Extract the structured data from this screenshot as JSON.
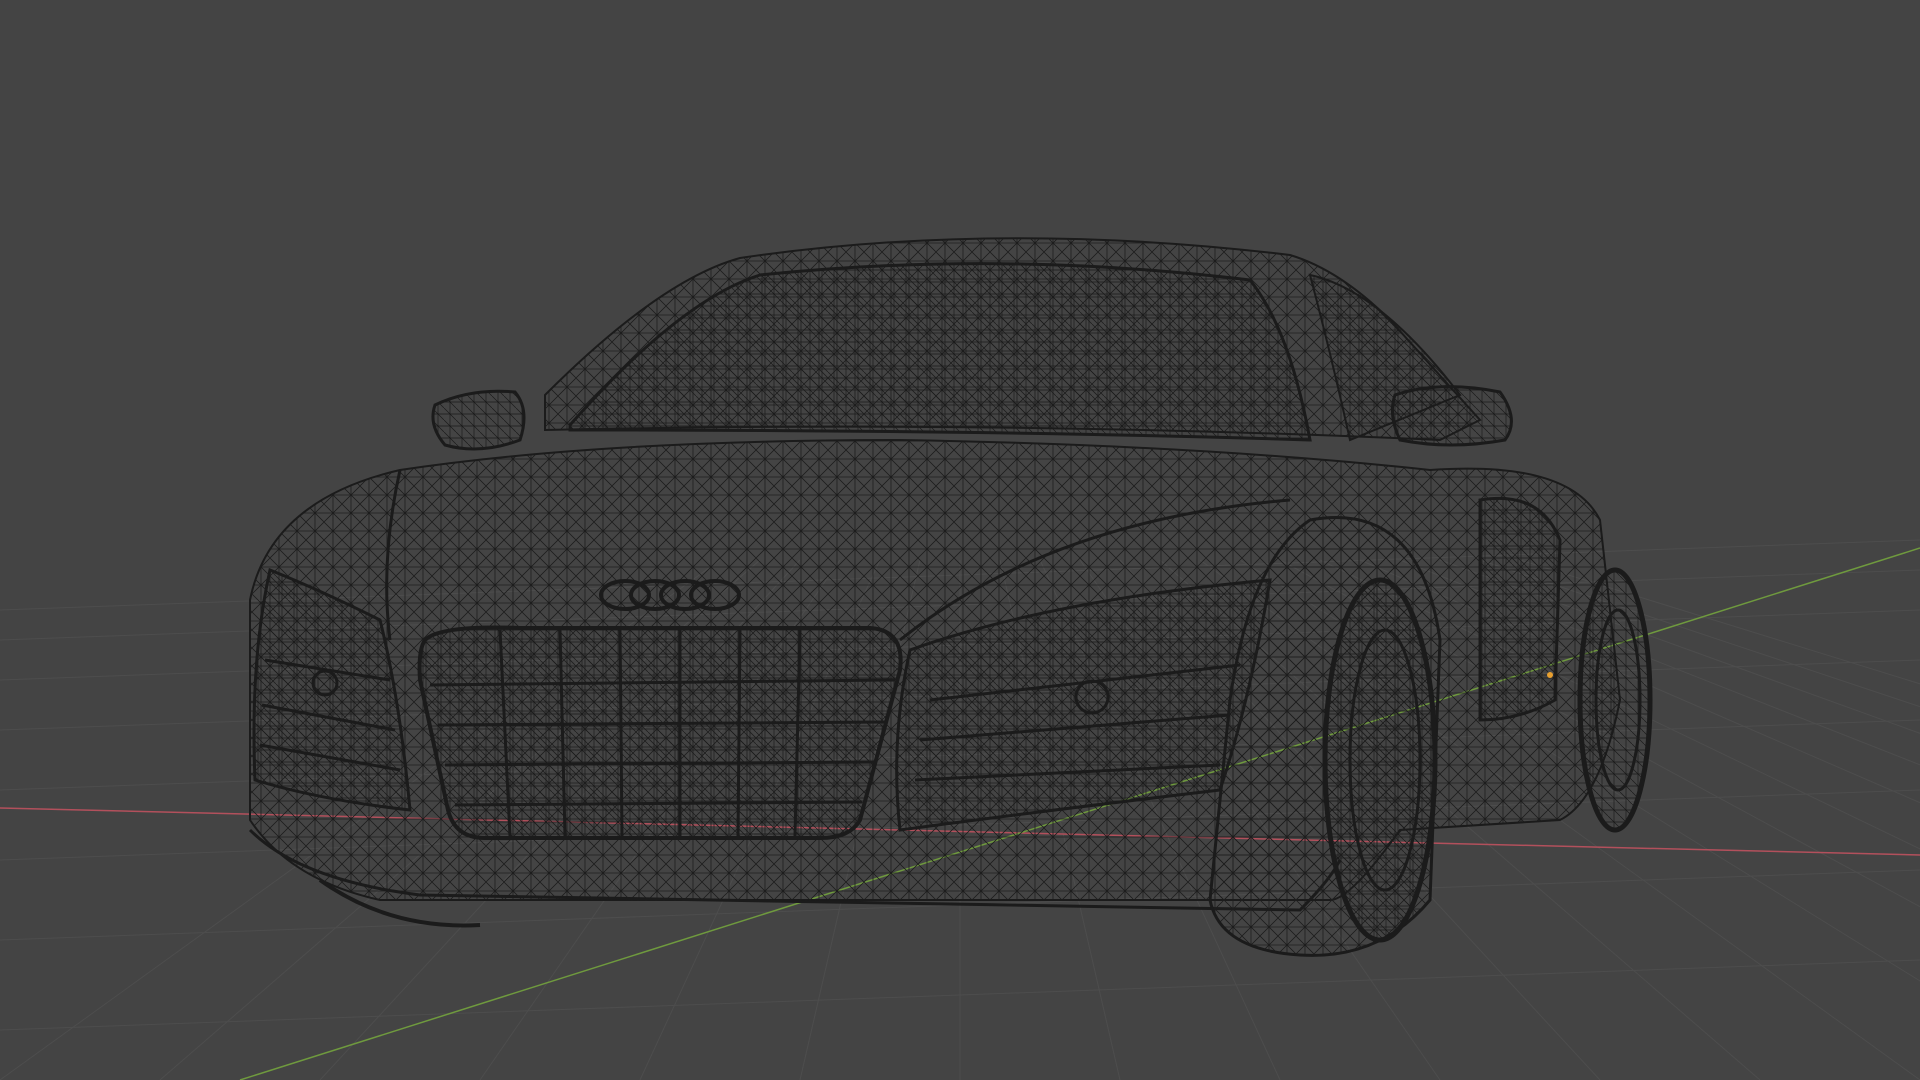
{
  "viewport": {
    "background_color": "#444444",
    "shading_mode": "wireframe"
  },
  "grid": {
    "visible": true,
    "line_color": "#4d4d4d",
    "x_axis_color": "#b3505c",
    "y_axis_color": "#6f9a3e"
  },
  "object": {
    "type": "car-model",
    "emblem": "four-rings-emblem",
    "wire_color": "#1c1c1c",
    "origin_marker_color": "#e8a030"
  }
}
